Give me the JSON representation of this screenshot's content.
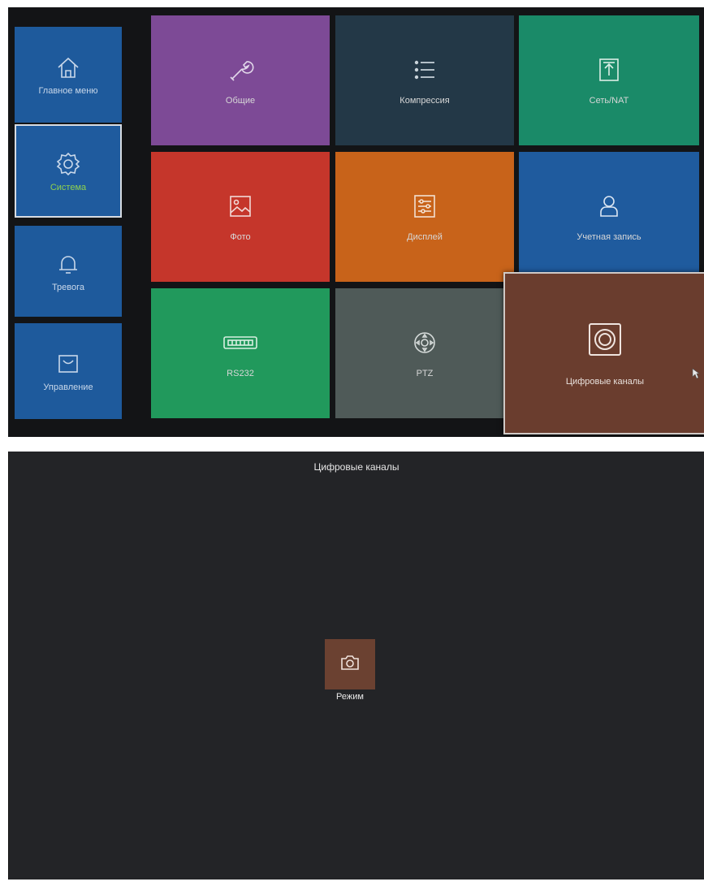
{
  "system_menu": {
    "sidebar": [
      {
        "label": "Главное меню",
        "icon": "home-icon",
        "active": false
      },
      {
        "label": "Система",
        "icon": "gear-icon",
        "active": true
      },
      {
        "label": "Тревога",
        "icon": "bell-icon",
        "active": false
      },
      {
        "label": "Управление",
        "icon": "box-icon",
        "active": false
      }
    ],
    "tiles": [
      {
        "label": "Общие",
        "icon": "wrench-icon",
        "color": "#7d4a96"
      },
      {
        "label": "Компрессия",
        "icon": "list-icon",
        "color": "#233847"
      },
      {
        "label": "Сеть/NAT",
        "icon": "upload-icon",
        "color": "#1a8a68"
      },
      {
        "label": "Фото",
        "icon": "image-icon",
        "color": "#c5362b"
      },
      {
        "label": "Дисплей",
        "icon": "sliders-icon",
        "color": "#c8631a"
      },
      {
        "label": "Учетная запись",
        "icon": "user-icon",
        "color": "#1f5b9e"
      },
      {
        "label": "RS232",
        "icon": "rs232-port-icon",
        "color": "#21995c"
      },
      {
        "label": "PTZ",
        "icon": "ptz-icon",
        "color": "#4f5a58"
      }
    ],
    "popup_tile": {
      "label": "Цифровые каналы",
      "icon": "digital-channel-icon",
      "color": "#6a3d2e"
    }
  },
  "digital_channels": {
    "title": "Цифровые каналы",
    "mode_button": {
      "label": "Режим",
      "icon": "camera-icon",
      "color": "#6b4131"
    }
  }
}
